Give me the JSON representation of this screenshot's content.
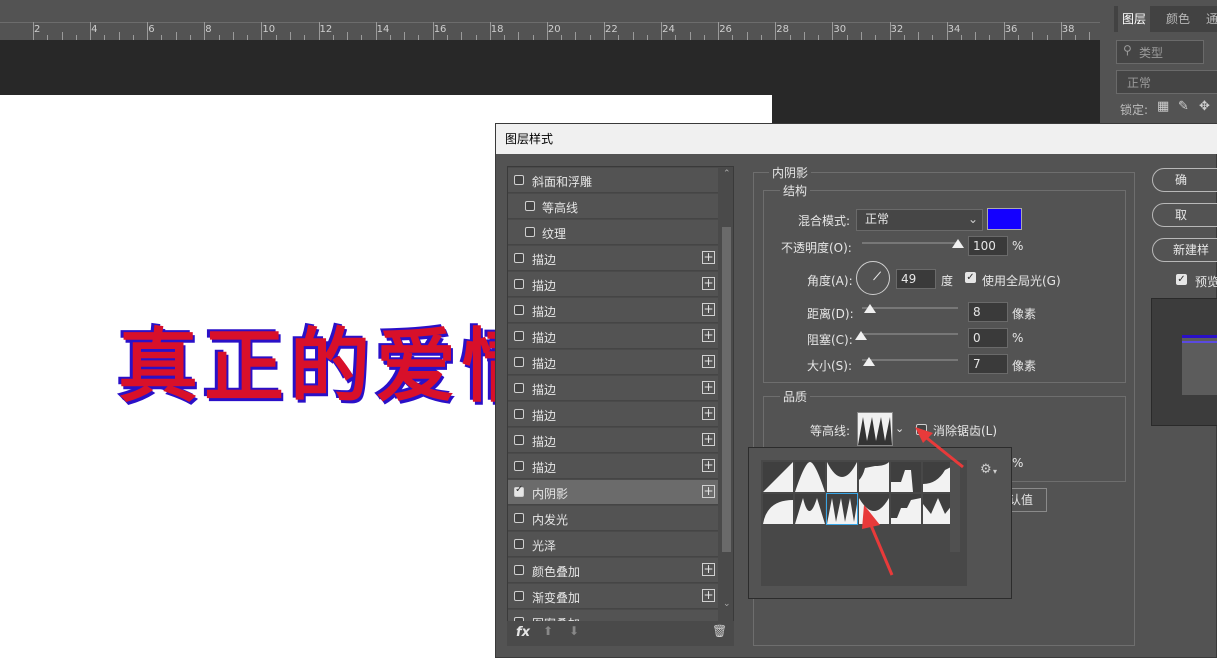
{
  "ruler": {
    "numbers": [
      "2",
      "4",
      "6",
      "8",
      "10",
      "12",
      "14",
      "16",
      "18",
      "20",
      "22",
      "24",
      "26",
      "28",
      "30",
      "32",
      "34",
      "36",
      "38"
    ]
  },
  "canvas": {
    "text": "真正的爱情"
  },
  "right_panel": {
    "tabs": [
      "图层",
      "颜色",
      "通"
    ],
    "search": "类型",
    "blend": "正常",
    "lock_label": "锁定:"
  },
  "dialog": {
    "title": "图层样式",
    "styles": [
      {
        "label": "斜面和浮雕",
        "checked": false,
        "indent": false,
        "plus": false
      },
      {
        "label": "等高线",
        "checked": false,
        "indent": true,
        "plus": false
      },
      {
        "label": "纹理",
        "checked": false,
        "indent": true,
        "plus": false
      },
      {
        "label": "描边",
        "checked": false,
        "indent": false,
        "plus": true
      },
      {
        "label": "描边",
        "checked": false,
        "indent": false,
        "plus": true
      },
      {
        "label": "描边",
        "checked": false,
        "indent": false,
        "plus": true
      },
      {
        "label": "描边",
        "checked": false,
        "indent": false,
        "plus": true
      },
      {
        "label": "描边",
        "checked": false,
        "indent": false,
        "plus": true
      },
      {
        "label": "描边",
        "checked": false,
        "indent": false,
        "plus": true
      },
      {
        "label": "描边",
        "checked": false,
        "indent": false,
        "plus": true
      },
      {
        "label": "描边",
        "checked": false,
        "indent": false,
        "plus": true
      },
      {
        "label": "描边",
        "checked": false,
        "indent": false,
        "plus": true
      },
      {
        "label": "内阴影",
        "checked": true,
        "indent": false,
        "plus": true,
        "selected": true
      },
      {
        "label": "内发光",
        "checked": false,
        "indent": false,
        "plus": false
      },
      {
        "label": "光泽",
        "checked": false,
        "indent": false,
        "plus": false
      },
      {
        "label": "颜色叠加",
        "checked": false,
        "indent": false,
        "plus": true
      },
      {
        "label": "渐变叠加",
        "checked": false,
        "indent": false,
        "plus": true
      },
      {
        "label": "图案叠加",
        "checked": false,
        "indent": false,
        "plus": false
      }
    ],
    "footer": {
      "fx": "fx"
    },
    "inner_shadow": {
      "title": "内阴影",
      "structure": {
        "title": "结构",
        "blend_mode_label": "混合模式:",
        "blend_mode_value": "正常",
        "color": "#1400ff",
        "opacity_label": "不透明度(O):",
        "opacity_value": "100",
        "opacity_value_num": 100,
        "opacity_unit": "%",
        "angle_label": "角度(A):",
        "angle_value": "49",
        "angle_unit": "度",
        "global_light_label": "使用全局光(G)",
        "global_light": true,
        "distance_label": "距离(D):",
        "distance_value": "8",
        "distance_unit": "像素",
        "choke_label": "阻塞(C):",
        "choke_value": "0",
        "choke_unit": "%",
        "size_label": "大小(S):",
        "size_value": "7",
        "size_unit": "像素"
      },
      "quality": {
        "title": "品质",
        "contour_label": "等高线:",
        "antialias_label": "消除锯齿(L)",
        "antialias": false,
        "noise_unit": "%",
        "default_btn": "认值"
      }
    },
    "buttons": {
      "ok": "确",
      "cancel": "取",
      "new_style": "新建样",
      "preview": "预览"
    }
  }
}
